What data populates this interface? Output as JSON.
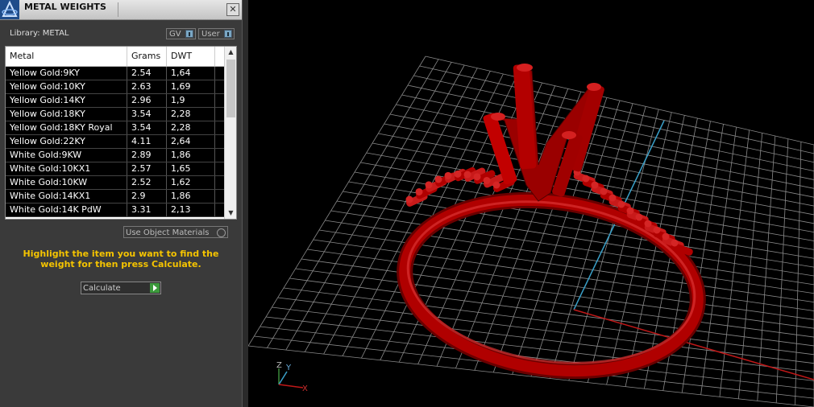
{
  "panel": {
    "title": "METAL WEIGHTS",
    "close_glyph": "✕",
    "library_label": "Library: METAL",
    "toggles": [
      {
        "label": "GV"
      },
      {
        "label": "User"
      }
    ],
    "columns": [
      "Metal",
      "Grams",
      "DWT"
    ],
    "rows": [
      {
        "metal": "Yellow Gold:9KY",
        "grams": "2.54",
        "dwt": "1,64"
      },
      {
        "metal": "Yellow Gold:10KY",
        "grams": "2.63",
        "dwt": "1,69"
      },
      {
        "metal": "Yellow Gold:14KY",
        "grams": "2.96",
        "dwt": "1,9"
      },
      {
        "metal": "Yellow Gold:18KY",
        "grams": "3.54",
        "dwt": "2,28"
      },
      {
        "metal": "Yellow Gold:18KY Royal",
        "grams": "3.54",
        "dwt": "2,28"
      },
      {
        "metal": "Yellow Gold:22KY",
        "grams": "4.11",
        "dwt": "2,64"
      },
      {
        "metal": "White Gold:9KW",
        "grams": "2.89",
        "dwt": "1,86"
      },
      {
        "metal": "White Gold:10KX1",
        "grams": "2.57",
        "dwt": "1,65"
      },
      {
        "metal": "White Gold:10KW",
        "grams": "2.52",
        "dwt": "1,62"
      },
      {
        "metal": "White Gold:14KX1",
        "grams": "2.9",
        "dwt": "1,86"
      },
      {
        "metal": "White Gold:14K PdW",
        "grams": "3.31",
        "dwt": "2,13"
      }
    ],
    "use_object_materials": "Use Object Materials",
    "instruction": "Highlight the item you want to find the weight for then press Calculate.",
    "calculate_label": "Calculate"
  },
  "viewport": {
    "axis_labels": {
      "z": "Z",
      "y": "Y",
      "x": "X"
    },
    "colors": {
      "ring": "#b00000",
      "grid": "#8a8a8a",
      "y_axis": "#3aa0c8",
      "x_axis": "#c01818",
      "z_axis": "#3a8a3a"
    }
  }
}
